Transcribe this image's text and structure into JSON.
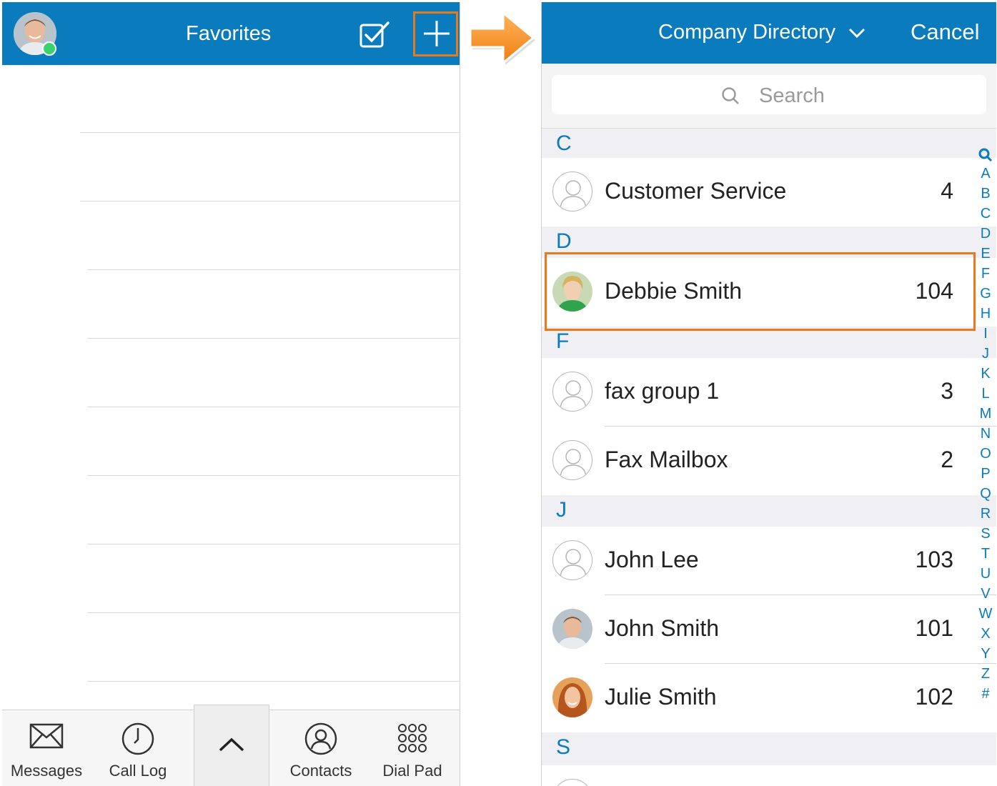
{
  "favorites": {
    "title": "Favorites",
    "tabs": [
      {
        "label": "Messages",
        "icon": "envelope-icon"
      },
      {
        "label": "Call Log",
        "icon": "clock-icon"
      },
      {
        "label": "",
        "icon": "chevron-up-icon"
      },
      {
        "label": "Contacts",
        "icon": "person-icon"
      },
      {
        "label": "Dial Pad",
        "icon": "dialpad-icon"
      }
    ]
  },
  "directory": {
    "title": "Company Directory",
    "cancel_label": "Cancel",
    "search_placeholder": "Search",
    "sections": [
      {
        "letter": "C",
        "contacts": [
          {
            "name": "Customer Service",
            "ext": "4"
          }
        ]
      },
      {
        "letter": "D",
        "contacts": [
          {
            "name": "Debbie Smith",
            "ext": "104"
          }
        ]
      },
      {
        "letter": "F",
        "contacts": [
          {
            "name": "fax group 1",
            "ext": "3"
          },
          {
            "name": "Fax Mailbox",
            "ext": "2"
          }
        ]
      },
      {
        "letter": "J",
        "contacts": [
          {
            "name": "John Lee",
            "ext": "103"
          },
          {
            "name": "John Smith",
            "ext": "101"
          },
          {
            "name": "Julie Smith",
            "ext": "102"
          }
        ]
      },
      {
        "letter": "S",
        "contacts": []
      }
    ],
    "index": [
      "A",
      "B",
      "C",
      "D",
      "E",
      "F",
      "G",
      "H",
      "I",
      "J",
      "K",
      "L",
      "M",
      "N",
      "O",
      "P",
      "Q",
      "R",
      "S",
      "T",
      "U",
      "V",
      "W",
      "X",
      "Y",
      "Z",
      "#"
    ]
  },
  "colors": {
    "brand": "#0a7bbd",
    "highlight": "#e8791c",
    "online": "#3bd16f"
  }
}
